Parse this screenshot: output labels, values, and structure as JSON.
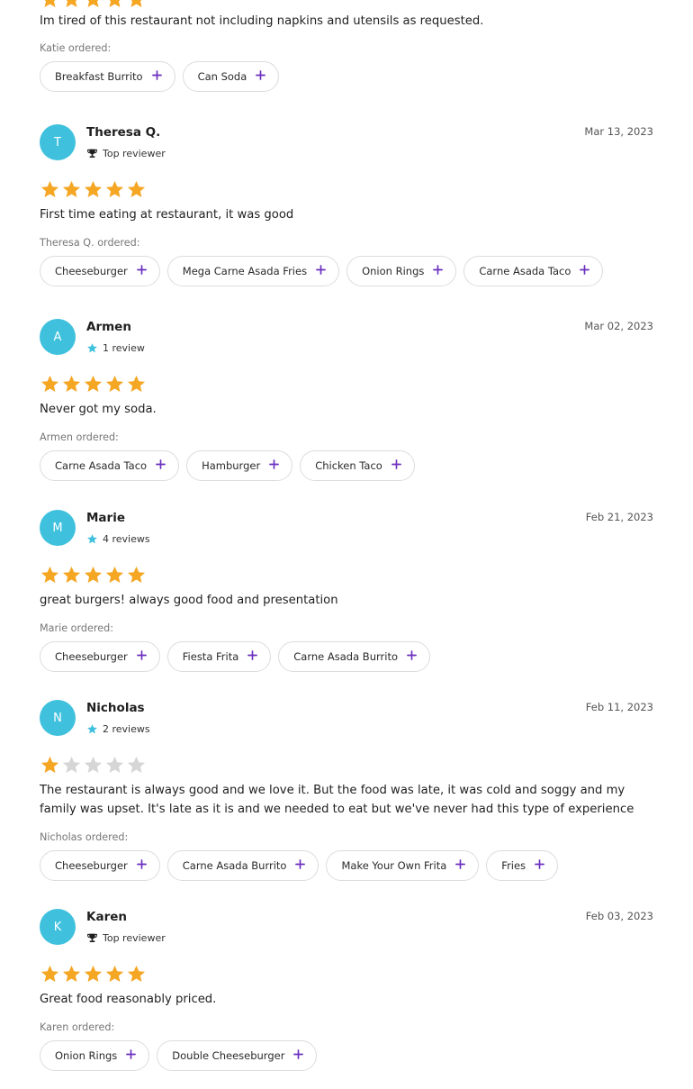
{
  "colors": {
    "avatar": "#3fc1de",
    "star_filled": "#f5a623",
    "star_empty": "#d6d6d6",
    "plus": "#6b2fbf",
    "badge_star": "#3fc1de"
  },
  "top_partial": {
    "rating": 5,
    "text": "Im tired of this restaurant not including napkins and utensils as requested.",
    "ordered_label": "Katie ordered:",
    "items": [
      "Breakfast Burrito",
      "Can Soda"
    ]
  },
  "reviews": [
    {
      "initial": "T",
      "name": "Theresa Q.",
      "date": "Mar 13, 2023",
      "badge_icon": "trophy-icon",
      "badge": "Top reviewer",
      "rating": 5,
      "text": "First time eating at restaurant, it was good",
      "ordered_label": "Theresa Q. ordered:",
      "items": [
        "Cheeseburger",
        "Mega Carne Asada Fries",
        "Onion Rings",
        "Carne Asada Taco"
      ]
    },
    {
      "initial": "A",
      "name": "Armen",
      "date": "Mar 02, 2023",
      "badge_icon": "star-icon",
      "badge": "1 review",
      "rating": 5,
      "text": "Never got my soda.",
      "ordered_label": "Armen ordered:",
      "items": [
        "Carne Asada Taco",
        "Hamburger",
        "Chicken Taco"
      ]
    },
    {
      "initial": "M",
      "name": "Marie",
      "date": "Feb 21, 2023",
      "badge_icon": "star-icon",
      "badge": "4 reviews",
      "rating": 5,
      "text": "great burgers! always good food and presentation",
      "ordered_label": "Marie ordered:",
      "items": [
        "Cheeseburger",
        "Fiesta Frita",
        "Carne Asada Burrito"
      ]
    },
    {
      "initial": "N",
      "name": "Nicholas",
      "date": "Feb 11, 2023",
      "badge_icon": "star-icon",
      "badge": "2 reviews",
      "rating": 1,
      "text": "The restaurant is always good and we love it. But the food was late, it was cold and soggy and my family was upset. It's late as it is and we needed to eat but we've never had this type of experience",
      "ordered_label": "Nicholas ordered:",
      "items": [
        "Cheeseburger",
        "Carne Asada Burrito",
        "Make Your Own Frita",
        "Fries"
      ]
    },
    {
      "initial": "K",
      "name": "Karen",
      "date": "Feb 03, 2023",
      "badge_icon": "trophy-icon",
      "badge": "Top reviewer",
      "rating": 5,
      "text": "Great food reasonably priced.",
      "ordered_label": "Karen ordered:",
      "items": [
        "Onion Rings",
        "Double Cheeseburger"
      ]
    }
  ]
}
